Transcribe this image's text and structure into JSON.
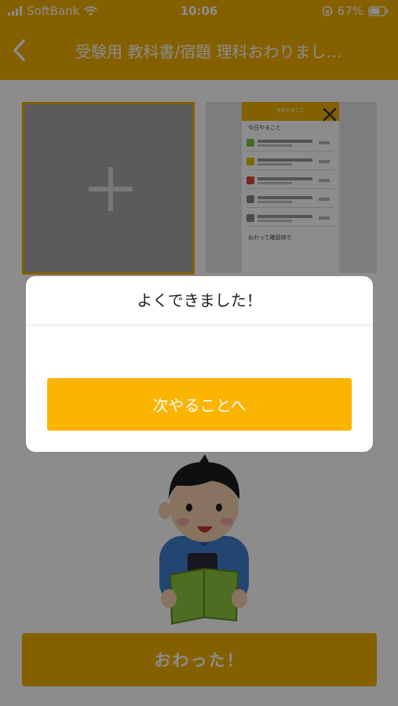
{
  "status_bar": {
    "carrier": "SoftBank",
    "time": "10:06",
    "battery": "67%"
  },
  "nav": {
    "title": "受験用 教科書/宿題 理科おわりまし…"
  },
  "thumbnail": {
    "header": "今日やること",
    "section_today": "今日やること",
    "section_done": "おわって確認待ち"
  },
  "dialog": {
    "title": "よくできました！",
    "next_label": "次やることへ"
  },
  "footer": {
    "done_label": "おわった！"
  },
  "colors": {
    "accent": "#f2b000",
    "button": "#fbb400"
  }
}
